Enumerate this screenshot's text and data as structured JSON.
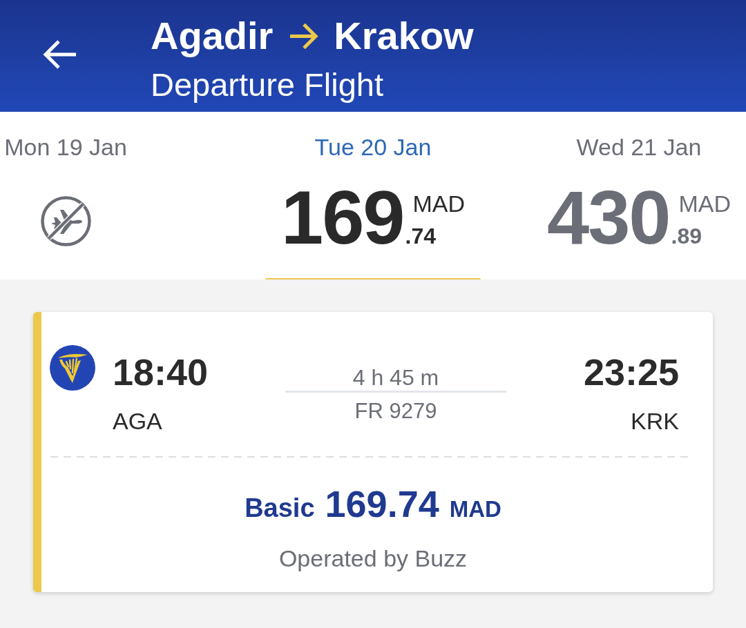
{
  "header": {
    "from": "Agadir",
    "to": "Krakow",
    "subtitle": "Departure Flight"
  },
  "days": [
    {
      "label": "Mon 19 Jan",
      "selected": false,
      "kind": "no_flight"
    },
    {
      "label": "Tue 20 Jan",
      "selected": true,
      "kind": "price",
      "price": "169",
      "decimals": ".74",
      "currency": "MAD"
    },
    {
      "label": "Wed 21 Jan",
      "selected": false,
      "kind": "price",
      "price": "430",
      "decimals": ".89",
      "currency": "MAD"
    }
  ],
  "flight": {
    "departure_time": "18:40",
    "departure_airport": "AGA",
    "duration": "4 h 45 m",
    "flight_number": "FR 9279",
    "arrival_time": "23:25",
    "arrival_airport": "KRK",
    "fare_name": "Basic",
    "fare_amount": "169.74",
    "fare_currency": "MAD",
    "operator": "Operated by Buzz"
  }
}
